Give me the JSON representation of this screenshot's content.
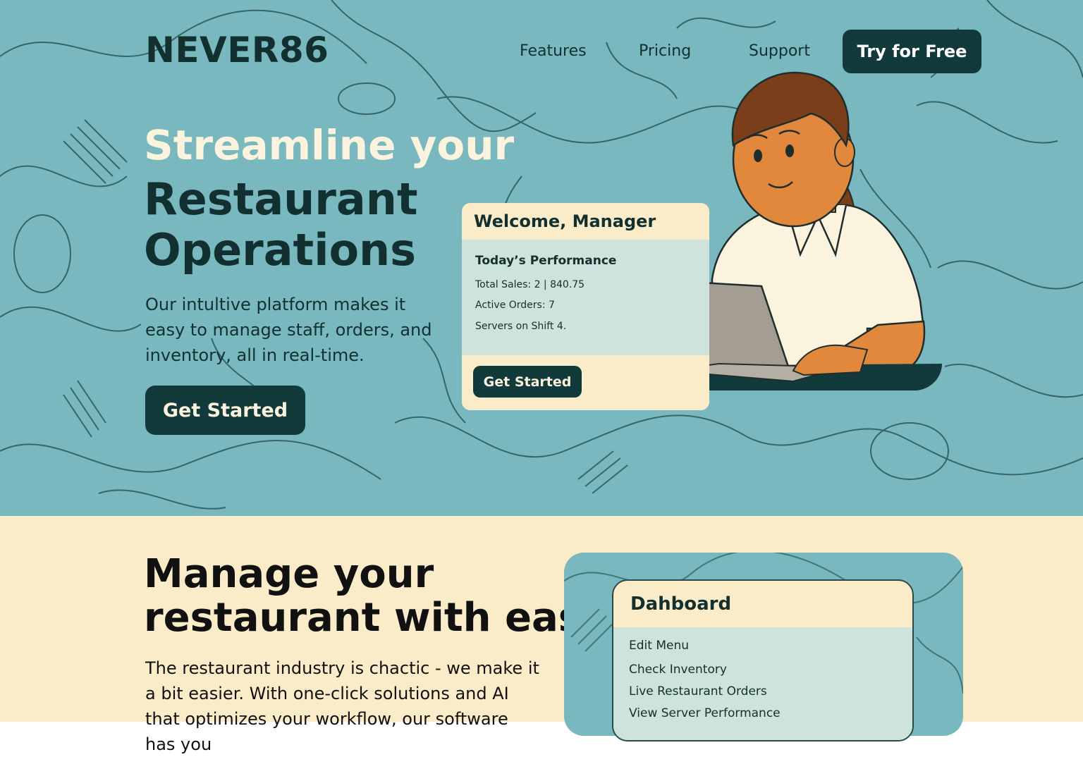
{
  "header": {
    "logo": "NEVER86",
    "nav": [
      "Features",
      "Pricing",
      "Support"
    ],
    "cta": "Try for Free"
  },
  "hero": {
    "headline_light": "Streamline your",
    "headline_dark_1": "Restaurant",
    "headline_dark_2": "Operations",
    "description": "Our intultive platform makes it easy to manage staff, orders, and inventory, all in real-time.",
    "button": "Get Started"
  },
  "welcome_card": {
    "title": "Welcome, Manager",
    "section_title": "Today’s Performance",
    "total_sales": "Total Sales: 2 | 840.75",
    "active_orders": "Active Orders: 7",
    "servers_on_shift": "Servers on Shift  4.",
    "button": "Get Started"
  },
  "features": {
    "headline_1": "Manage your",
    "headline_2": "restaurant with ease",
    "description": "The restaurant industry is chactic - we make it a bit easier. With one-click solutions and AI that optimizes your workflow, our software has you"
  },
  "dashboard": {
    "title": "Dahboard",
    "items": [
      "Edit Menu",
      "Check Inventory",
      "Live Restaurant Orders",
      "View Server Performance"
    ]
  },
  "colors": {
    "teal_bg": "#79b8bf",
    "cream_bg": "#fbecc9",
    "dark_green": "#133a3a",
    "panel": "#cde3dc",
    "skin": "#e2883c",
    "hair": "#7a3f1a"
  }
}
